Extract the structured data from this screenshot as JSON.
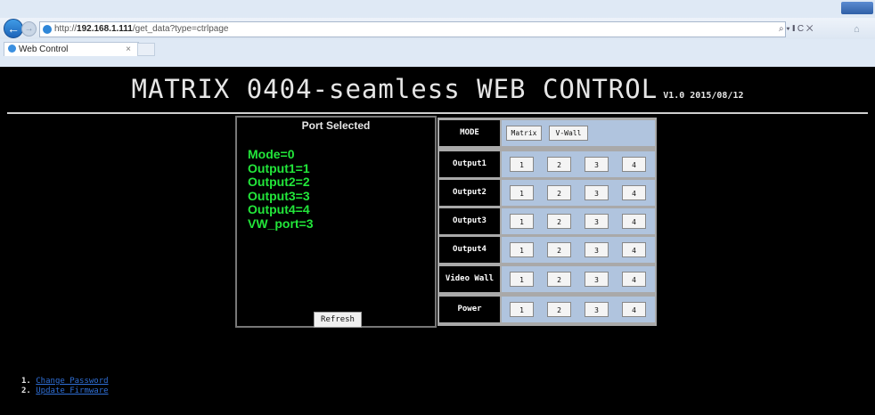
{
  "browser": {
    "url_prefix": "http://",
    "url_host": "192.168.1.111",
    "url_path": "/get_data?type=ctrlpage",
    "search_tools": "⌕ ▾ ❙ C ✕",
    "tab_title": "Web Control",
    "tab_close": "×",
    "back_arrow": "←",
    "forward_arrow": "→",
    "home_icon": "⌂"
  },
  "page": {
    "title": "MATRIX 0404-seamless WEB CONTROL",
    "version": "V1.0 2015/08/12"
  },
  "status": {
    "header": "Port Selected",
    "lines": [
      "Mode=0",
      "Output1=1",
      "Output2=2",
      "Output3=3",
      "Output4=4",
      "VW_port=3"
    ],
    "refresh_label": "Refresh"
  },
  "controls": {
    "mode": {
      "label": "MODE",
      "buttons": [
        "Matrix",
        "V-Wall"
      ]
    },
    "rows": [
      {
        "label": "Output1",
        "buttons": [
          "1",
          "2",
          "3",
          "4"
        ]
      },
      {
        "label": "Output2",
        "buttons": [
          "1",
          "2",
          "3",
          "4"
        ]
      },
      {
        "label": "Output3",
        "buttons": [
          "1",
          "2",
          "3",
          "4"
        ]
      },
      {
        "label": "Output4",
        "buttons": [
          "1",
          "2",
          "3",
          "4"
        ]
      },
      {
        "label": "Video Wall",
        "buttons": [
          "1",
          "2",
          "3",
          "4"
        ]
      },
      {
        "label": "Power",
        "buttons": [
          "1",
          "2",
          "3",
          "4"
        ]
      }
    ]
  },
  "footer": {
    "links": [
      {
        "num": "1.",
        "text": "Change Password"
      },
      {
        "num": "2.",
        "text": "Update Firmware"
      }
    ]
  },
  "colors": {
    "background": "#000000",
    "status_text": "#22e63a",
    "cell_bg": "#b0c4de",
    "link": "#2f6fd6"
  }
}
